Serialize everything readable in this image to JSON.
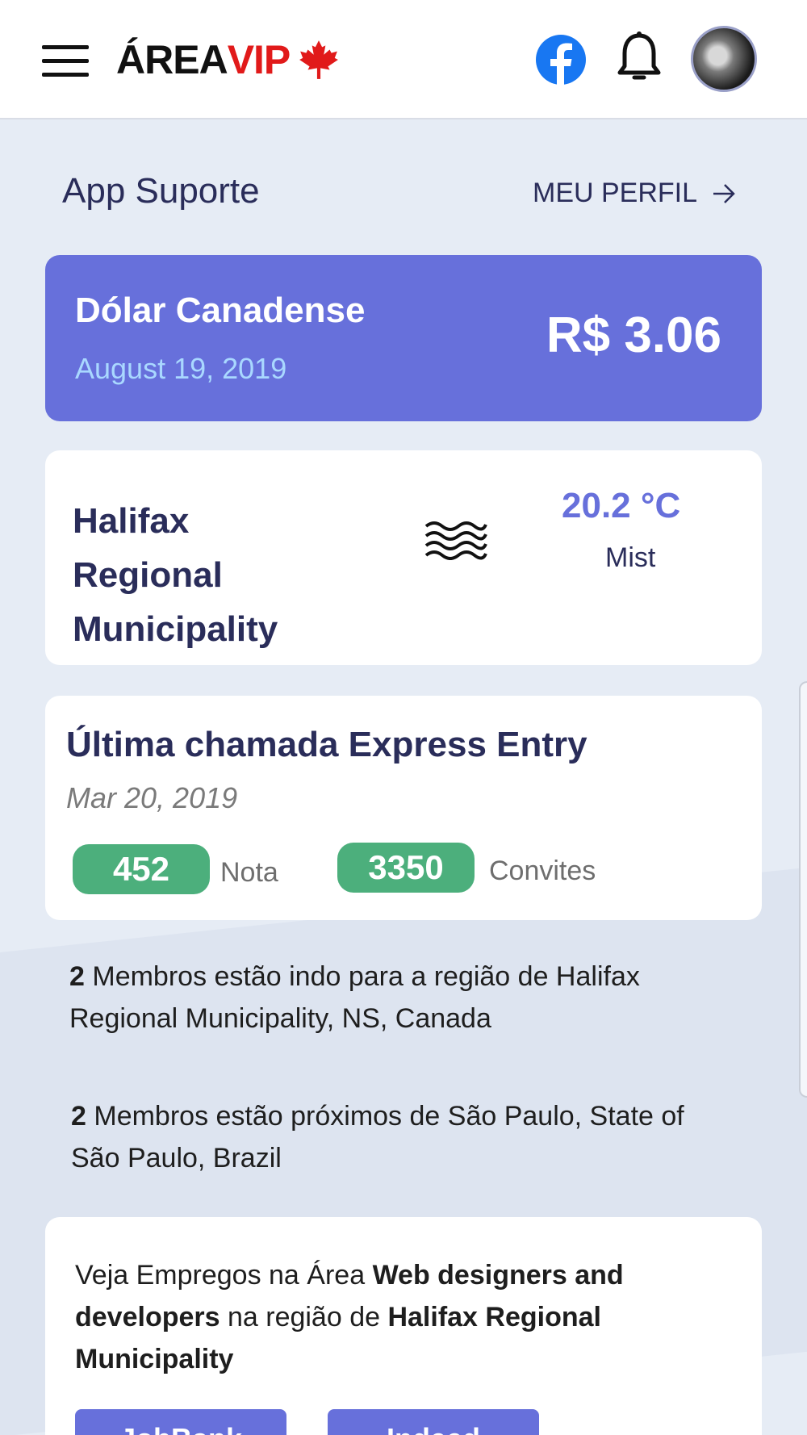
{
  "header": {
    "logo_part1": "ÁREA",
    "logo_part2": "VIP",
    "accent_color": "#e11a1a"
  },
  "section": {
    "title": "App Suporte",
    "profile_link": "MEU PERFIL"
  },
  "currency": {
    "name": "Dólar Canadense",
    "date": "August 19, 2019",
    "value": "R$ 3.06",
    "card_color": "#6770db"
  },
  "weather": {
    "city": "Halifax Regional Municipality",
    "temperature": "20.2 °C",
    "description": "Mist",
    "icon": "mist-icon"
  },
  "express_entry": {
    "title": "Última chamada Express Entry",
    "date": "Mar 20, 2019",
    "score": "452",
    "score_label": "Nota",
    "invites": "3350",
    "invites_label": "Convites",
    "pill_color": "#4caf7c"
  },
  "members": [
    {
      "count": "2",
      "text": " Membros estão indo para a região de  Halifax Regional Municipality, NS, Canada"
    },
    {
      "count": "2",
      "text": " Membros estão próximos de  São Paulo, State of São Paulo, Brazil"
    }
  ],
  "jobs": {
    "prefix": "Veja Empregos na Área ",
    "area": "Web designers and developers",
    "middle": " na região de  ",
    "region": "Halifax Regional Municipality",
    "buttons": [
      "JobBank",
      "Indeed"
    ]
  }
}
